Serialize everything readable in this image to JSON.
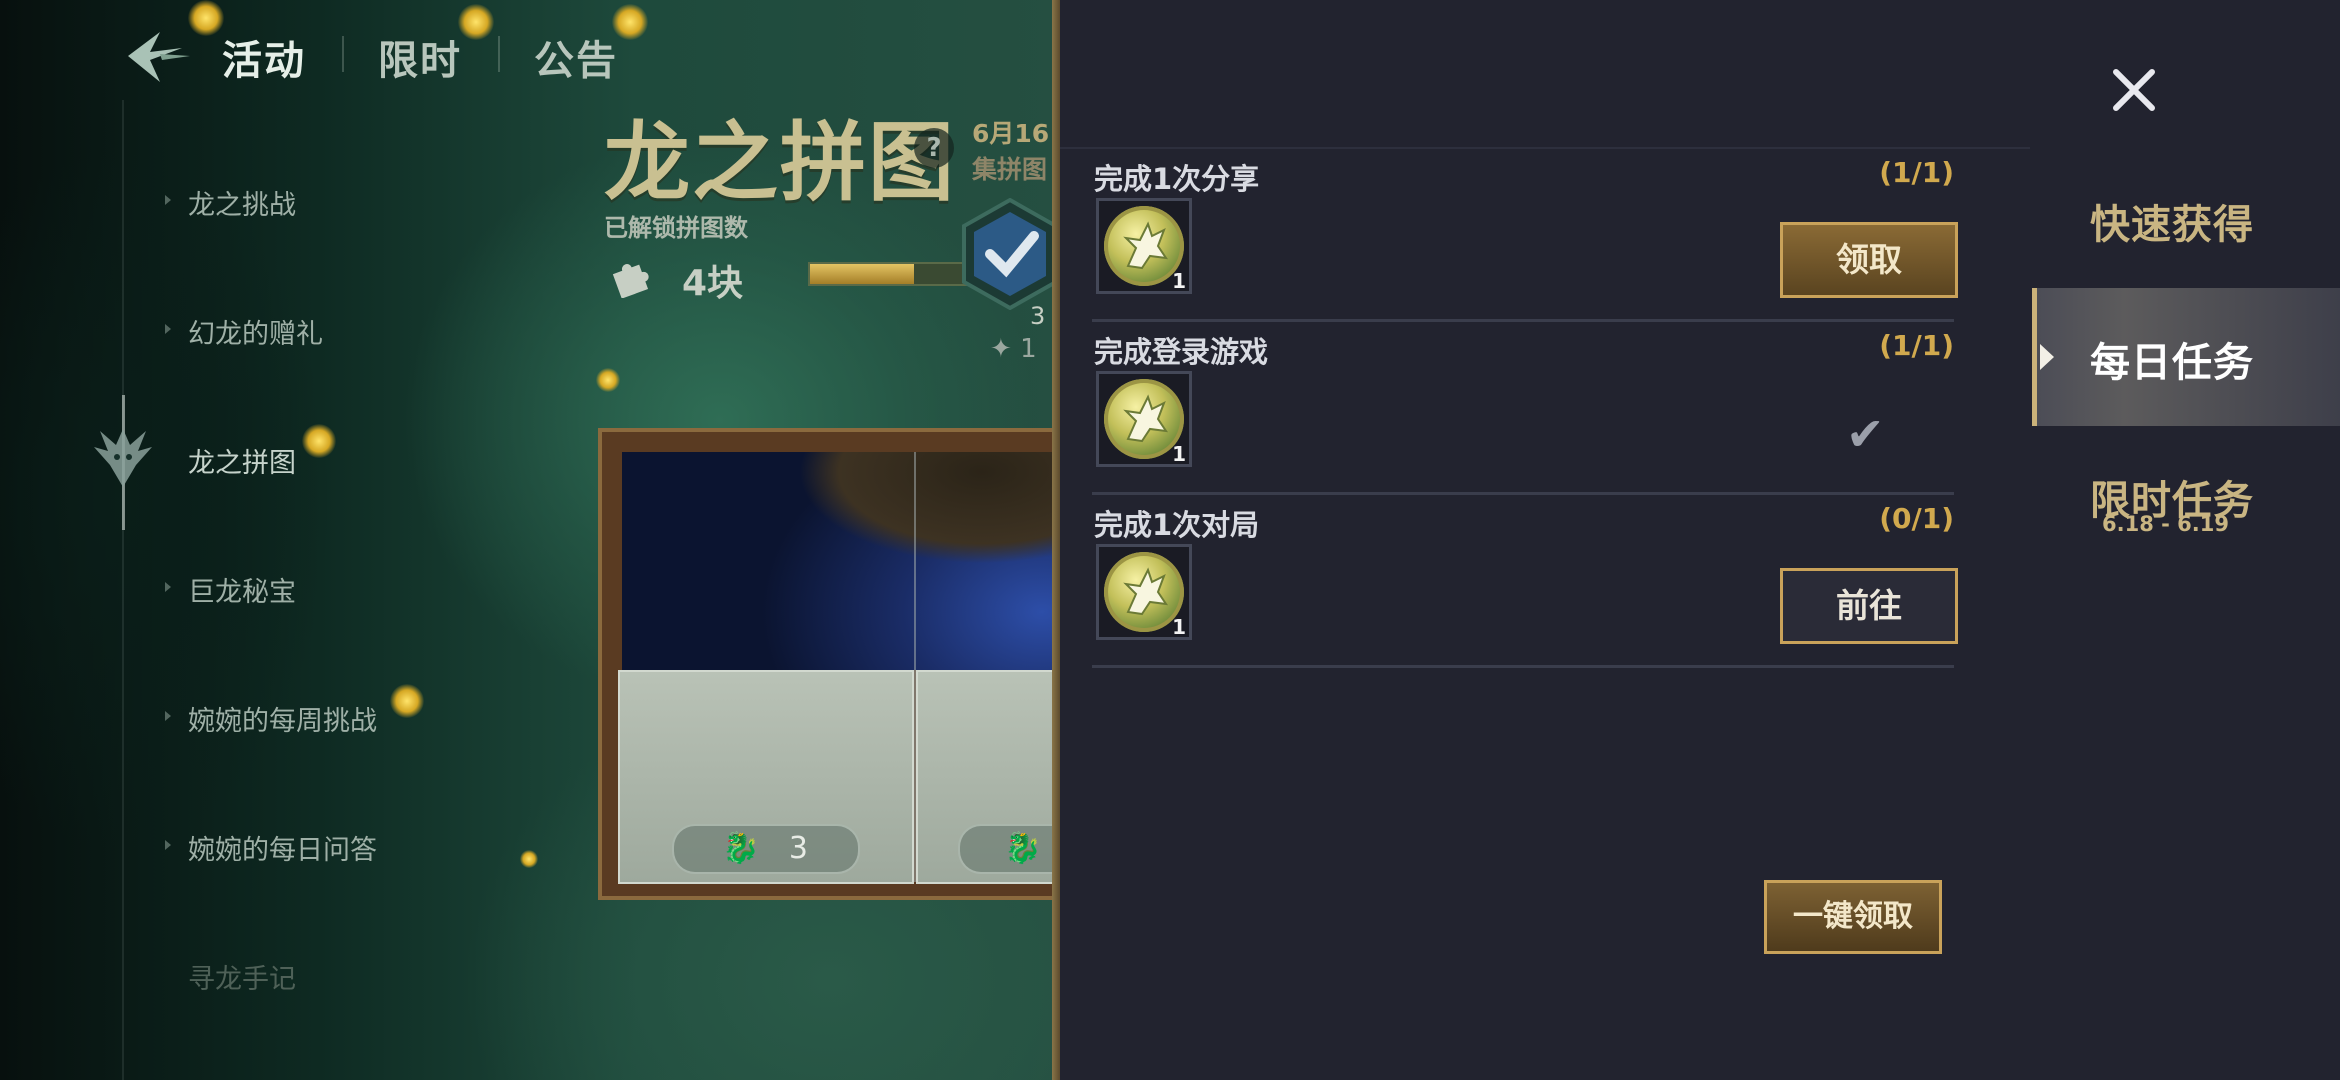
{
  "nav": {
    "tabs": [
      {
        "label": "活动",
        "active": true
      },
      {
        "label": "限时",
        "active": false
      },
      {
        "label": "公告",
        "active": false
      }
    ]
  },
  "sidebar": {
    "items": [
      {
        "label": "龙之挑战"
      },
      {
        "label": "幻龙的赠礼"
      },
      {
        "label": "龙之拼图",
        "active": true
      },
      {
        "label": "巨龙秘宝"
      },
      {
        "label": "婉婉的每周挑战"
      },
      {
        "label": "婉婉的每日问答"
      },
      {
        "label": "寻龙手记"
      }
    ]
  },
  "puzzle": {
    "title": "龙之拼图",
    "help": "?",
    "date_partial": "6月16",
    "collect_partial": "集拼图",
    "unlocked_label": "已解锁拼图数",
    "unlocked_count": "4块",
    "progress_fraction": 0.65,
    "reward_num": "3",
    "reward_sub": "1",
    "tile_values": [
      "3"
    ]
  },
  "tasks": [
    {
      "title": "完成1次分享",
      "progress": "(1/1)",
      "reward_qty": "1",
      "action": "claim",
      "button_label": "领取"
    },
    {
      "title": "完成登录游戏",
      "progress": "(1/1)",
      "reward_qty": "1",
      "action": "done",
      "done_mark": "✔"
    },
    {
      "title": "完成1次对局",
      "progress": "(0/1)",
      "reward_qty": "1",
      "action": "go",
      "button_label": "前往"
    }
  ],
  "claim_all_label": "一键领取",
  "right_tabs": {
    "quick": "快速获得",
    "daily": "每日任务",
    "limited": "限时任务",
    "limited_dates": "6.18 - 6.19"
  },
  "colors": {
    "panel_bg": "#22232f",
    "gold_accent": "#c9a25a",
    "progress_text": "#d1a94e"
  }
}
